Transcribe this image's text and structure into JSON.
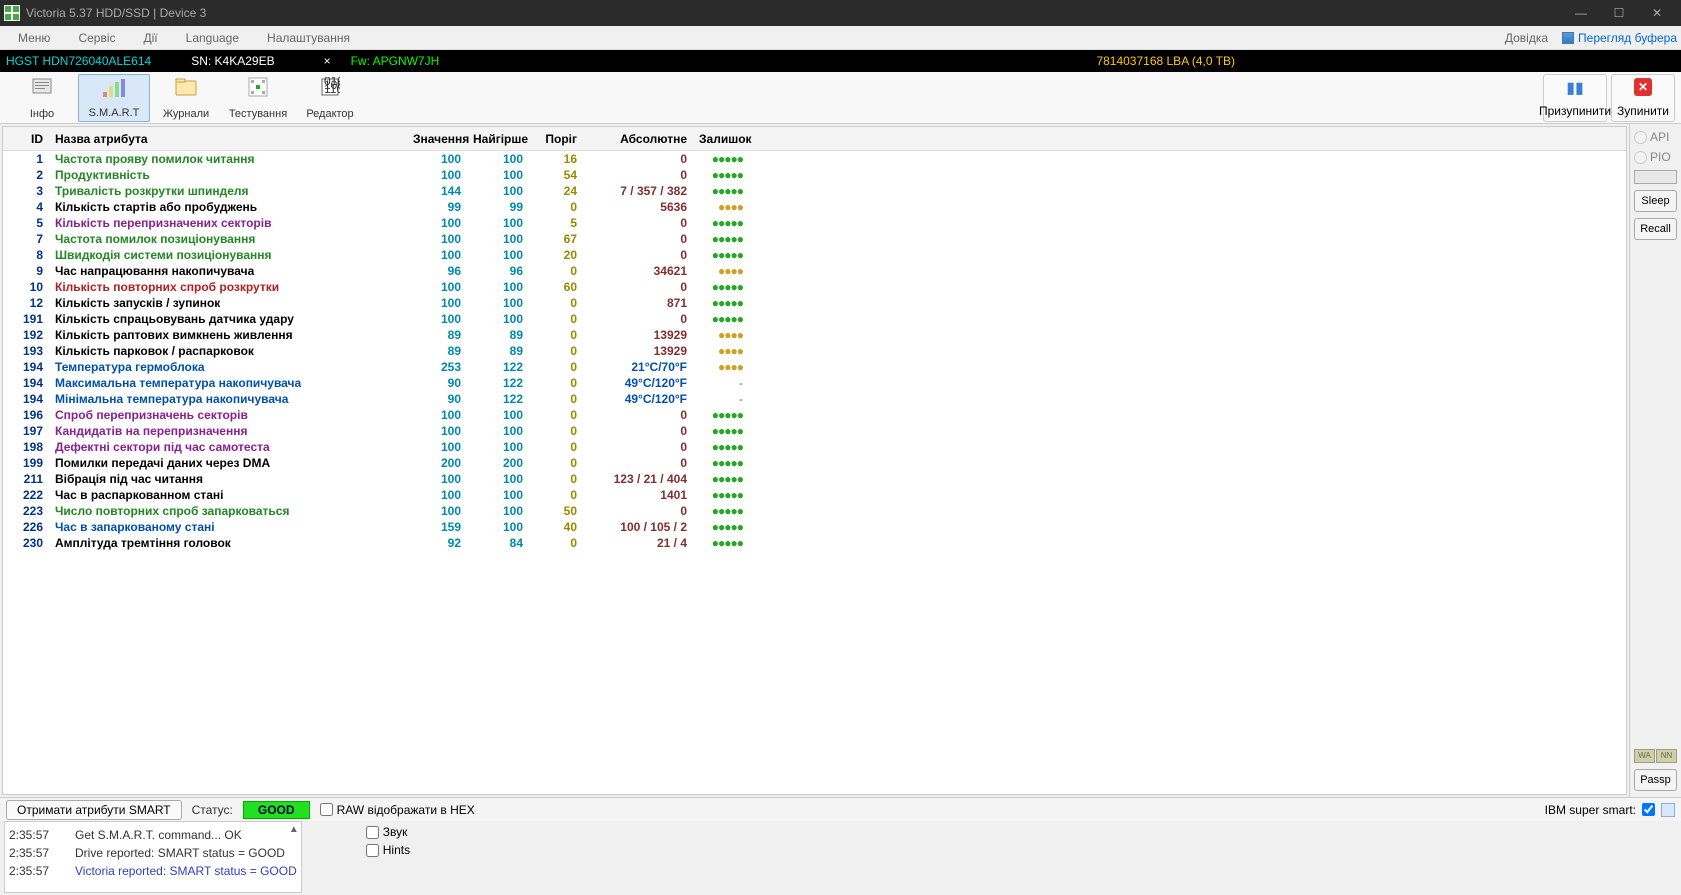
{
  "window": {
    "title": "Victoria 5.37 HDD/SSD | Device 3"
  },
  "menu": {
    "items": [
      "Меню",
      "Сервіс",
      "Дії",
      "Language",
      "Налаштування"
    ],
    "help": "Довідка",
    "buffer": "Перегляд буфера"
  },
  "info": {
    "drive": "HGST HDN726040ALE614",
    "sn": "SN: K4KA29EB",
    "fw": "Fw: APGNW7JH",
    "lba": "7814037168 LBA (4,0 TB)"
  },
  "toolbar": {
    "info": "Інфо",
    "smart": "S.M.A.R.T",
    "logs": "Журнали",
    "test": "Тестування",
    "editor": "Редактор",
    "pause": "Призупинити",
    "stop": "Зупинити"
  },
  "headers": {
    "id": "ID",
    "name": "Назва атрибута",
    "val": "Значення",
    "worst": "Найгірше",
    "thr": "Поріг",
    "abs": "Абсолютне",
    "rem": "Залишок"
  },
  "attrs": [
    {
      "id": "1",
      "name": "Частота прояву помилок читання",
      "cls": "name-green",
      "val": "100",
      "worst": "100",
      "thr": "16",
      "abs": "0",
      "rem": "g"
    },
    {
      "id": "2",
      "name": "Продуктивність",
      "cls": "name-green",
      "val": "100",
      "worst": "100",
      "thr": "54",
      "abs": "0",
      "rem": "g"
    },
    {
      "id": "3",
      "name": "Тривалість розкрутки шпинделя",
      "cls": "name-green",
      "val": "144",
      "worst": "100",
      "thr": "24",
      "abs": "7 / 357 / 382",
      "rem": "g"
    },
    {
      "id": "4",
      "name": "Кількість стартів або пробуджень",
      "cls": "name-black",
      "val": "99",
      "worst": "99",
      "thr": "0",
      "abs": "5636",
      "rem": "y"
    },
    {
      "id": "5",
      "name": "Кількість перепризначених секторів",
      "cls": "name-purple",
      "val": "100",
      "worst": "100",
      "thr": "5",
      "abs": "0",
      "rem": "g"
    },
    {
      "id": "7",
      "name": "Частота помилок позиціонування",
      "cls": "name-green",
      "val": "100",
      "worst": "100",
      "thr": "67",
      "abs": "0",
      "rem": "g"
    },
    {
      "id": "8",
      "name": "Швидкодія системи позиціонування",
      "cls": "name-green",
      "val": "100",
      "worst": "100",
      "thr": "20",
      "abs": "0",
      "rem": "g"
    },
    {
      "id": "9",
      "name": "Час напрацювання накопичувача",
      "cls": "name-black",
      "val": "96",
      "worst": "96",
      "thr": "0",
      "abs": "34621",
      "rem": "y"
    },
    {
      "id": "10",
      "name": "Кількість повторних спроб розкрутки",
      "cls": "name-red",
      "val": "100",
      "worst": "100",
      "thr": "60",
      "abs": "0",
      "rem": "g"
    },
    {
      "id": "12",
      "name": "Кількість запусків / зупинок",
      "cls": "name-black",
      "val": "100",
      "worst": "100",
      "thr": "0",
      "abs": "871",
      "rem": "g"
    },
    {
      "id": "191",
      "name": "Кількість спрацьовувань датчика удару",
      "cls": "name-black",
      "val": "100",
      "worst": "100",
      "thr": "0",
      "abs": "0",
      "rem": "g"
    },
    {
      "id": "192",
      "name": "Кількість раптових вимкнень живлення",
      "cls": "name-black",
      "val": "89",
      "worst": "89",
      "thr": "0",
      "abs": "13929",
      "rem": "y"
    },
    {
      "id": "193",
      "name": "Кількість парковок / распарковок",
      "cls": "name-black",
      "val": "89",
      "worst": "89",
      "thr": "0",
      "abs": "13929",
      "rem": "y"
    },
    {
      "id": "194",
      "name": "Температура гермоблока",
      "cls": "name-blue",
      "val": "253",
      "worst": "122",
      "thr": "0",
      "abs": "21°C/70°F",
      "abscls": "abs-blue",
      "rem": "y"
    },
    {
      "id": "194",
      "name": "Максимальна температура накопичувача",
      "cls": "name-blue",
      "val": "90",
      "worst": "122",
      "thr": "0",
      "abs": "49°C/120°F",
      "abscls": "abs-blue",
      "rem": "-"
    },
    {
      "id": "194",
      "name": "Мінімальна температура накопичувача",
      "cls": "name-blue",
      "val": "90",
      "worst": "122",
      "thr": "0",
      "abs": "49°C/120°F",
      "abscls": "abs-blue",
      "rem": "-"
    },
    {
      "id": "196",
      "name": "Спроб перепризначень секторів",
      "cls": "name-purple",
      "val": "100",
      "worst": "100",
      "thr": "0",
      "abs": "0",
      "rem": "g"
    },
    {
      "id": "197",
      "name": "Кандидатів на перепризначення",
      "cls": "name-purple",
      "val": "100",
      "worst": "100",
      "thr": "0",
      "abs": "0",
      "rem": "g"
    },
    {
      "id": "198",
      "name": "Дефектні сектори під час самотеста",
      "cls": "name-purple",
      "val": "100",
      "worst": "100",
      "thr": "0",
      "abs": "0",
      "rem": "g"
    },
    {
      "id": "199",
      "name": "Помилки передачі даних через DMA",
      "cls": "name-black",
      "val": "200",
      "worst": "200",
      "thr": "0",
      "abs": "0",
      "rem": "g"
    },
    {
      "id": "211",
      "name": "Вібрація під час читання",
      "cls": "name-black",
      "val": "100",
      "worst": "100",
      "thr": "0",
      "abs": "123 / 21 / 404",
      "rem": "g"
    },
    {
      "id": "222",
      "name": "Час в распаркованном стані",
      "cls": "name-black",
      "val": "100",
      "worst": "100",
      "thr": "0",
      "abs": "1401",
      "rem": "g"
    },
    {
      "id": "223",
      "name": "Число повторних спроб запарковаться",
      "cls": "name-green",
      "val": "100",
      "worst": "100",
      "thr": "50",
      "abs": "0",
      "rem": "g"
    },
    {
      "id": "226",
      "name": "Час в запаркованому стані",
      "cls": "name-blue",
      "val": "159",
      "worst": "100",
      "thr": "40",
      "abs": "100 / 105 / 2",
      "rem": "g"
    },
    {
      "id": "230",
      "name": "Амплітуда тремтіння головок",
      "cls": "name-black",
      "val": "92",
      "worst": "84",
      "thr": "0",
      "abs": "21 / 4",
      "rem": "g"
    }
  ],
  "side": {
    "api": "API",
    "pio": "PIO",
    "sleep": "Sleep",
    "recall": "Recall",
    "passp": "Passp",
    "b1": "WA",
    "b2": "NN"
  },
  "bottom": {
    "get": "Отримати атрибути SMART",
    "status": "Статус:",
    "good": "GOOD",
    "rawhex": "RAW відображати в HEX",
    "ibm": "IBM super smart:"
  },
  "log": {
    "rows": [
      {
        "t": "2:35:57",
        "m": "Get S.M.A.R.T. command... OK",
        "c": ""
      },
      {
        "t": "2:35:57",
        "m": "Drive reported: SMART status = GOOD",
        "c": ""
      },
      {
        "t": "2:35:57",
        "m": "Victoria reported: SMART status = GOOD",
        "c": "blue"
      }
    ]
  },
  "logside": {
    "sound": "Звук",
    "hints": "Hints"
  }
}
